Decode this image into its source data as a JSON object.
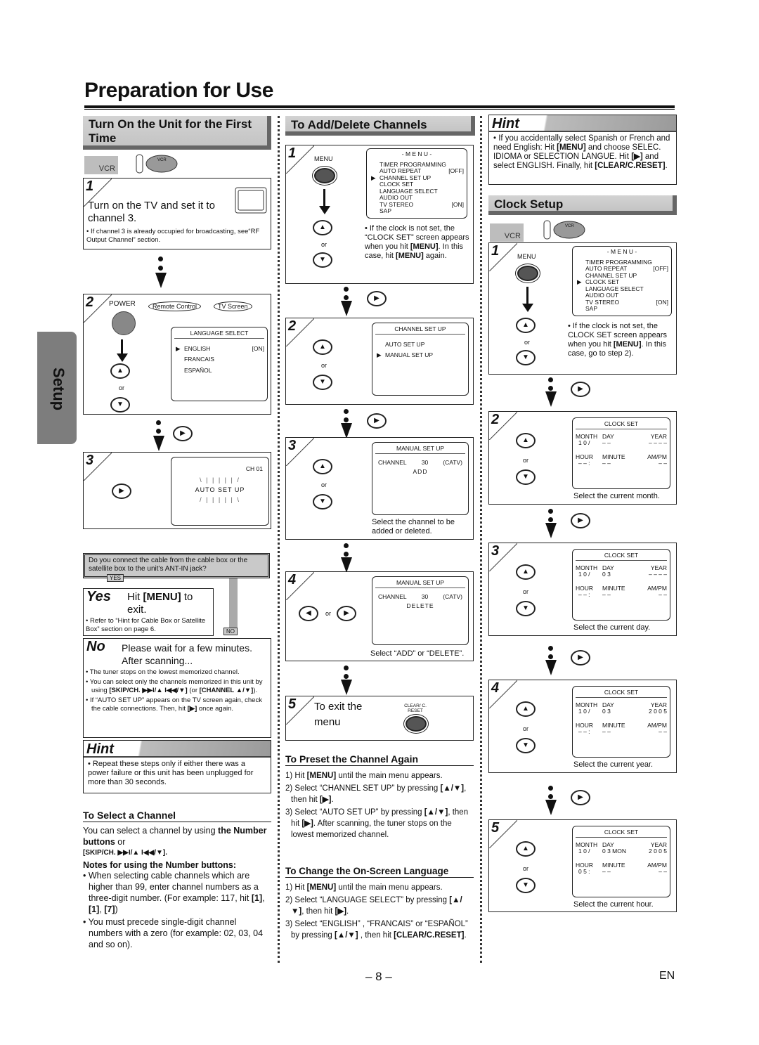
{
  "page": {
    "title": "Preparation for Use",
    "side_tab": "Setup",
    "page_number": "– 8 –",
    "language": "EN"
  },
  "col1": {
    "heading": "Turn On the Unit for the First Time",
    "vcr_label": "VCR",
    "step1": {
      "num": "1",
      "text": "Turn on the TV and set it to channel 3.",
      "note": "• If channel 3 is already occupied for broadcasting, see“RF Output Channel” section."
    },
    "step2": {
      "num": "2",
      "power_label": "POWER",
      "callout_remote": "Remote Control",
      "callout_tv": "TV Screen",
      "or": "or",
      "screen": {
        "header": "LANGUAGE SELECT",
        "items": [
          {
            "label": "ENGLISH",
            "value": "[ON]",
            "selected": true
          },
          {
            "label": "FRANCAIS",
            "value": "",
            "selected": false
          },
          {
            "label": "ESPAÑOL",
            "value": "",
            "selected": false
          }
        ]
      }
    },
    "step3": {
      "num": "3",
      "channel": "CH 01",
      "flashing": "AUTO SET UP"
    },
    "question": "Do you connect the cable from the cable box or the satellite box to the unit’s ANT-IN jack?",
    "yes_tag": "YES",
    "no_tag": "NO",
    "yes": {
      "label": "Yes",
      "text_pre": "Hit ",
      "text_key": "[MENU]",
      "text_post": " to exit.",
      "note": "• Refer to “Hint for Cable Box or Satellite Box” section on page 6."
    },
    "no": {
      "label": "No",
      "text": "Please wait for a few minutes. After scanning...",
      "notes": [
        "• The tuner stops on the lowest memorized channel.",
        "• You can select only the channels memorized in this unit by using [SKIP/CH. ▶▶I/▲ I◀◀/▼] (or [CHANNEL ▲/▼]).",
        "• If “AUTO SET UP” appears on the TV screen again, check the cable connections. Then, hit [▶] once again."
      ]
    },
    "hint": {
      "title": "Hint",
      "text": "• Repeat these steps only if either there was a power failure or this unit has been unplugged for more than 30 seconds."
    },
    "select_channel": {
      "heading": "To Select a Channel",
      "intro_pre": "You can select a channel by using ",
      "intro_bold": "the Number buttons",
      "intro_post": " or",
      "skip_key": "[SKIP/CH. ▶▶I/▲ I◀◀/▼].",
      "notes_heading": "Notes for using the Number buttons:",
      "notes": [
        "• When selecting cable channels which are higher than 99, enter channel numbers as a three-digit number. (For example: 117, hit [1], [1], [7])",
        "• You must precede single-digit channel numbers with a zero (for example: 02, 03, 04 and so on)."
      ]
    }
  },
  "col2": {
    "heading": "To Add/Delete Channels",
    "step1": {
      "num": "1",
      "menu_label": "MENU",
      "or": "or",
      "screen": {
        "header": "- M E N U -",
        "items": [
          {
            "label": "TIMER PROGRAMMING",
            "value": "",
            "selected": false
          },
          {
            "label": "AUTO REPEAT",
            "value": "[OFF]",
            "selected": false
          },
          {
            "label": "CHANNEL SET UP",
            "value": "",
            "selected": true
          },
          {
            "label": "CLOCK SET",
            "value": "",
            "selected": false
          },
          {
            "label": "LANGUAGE SELECT",
            "value": "",
            "selected": false
          },
          {
            "label": "AUDIO OUT",
            "value": "",
            "selected": false
          },
          {
            "label": "TV STEREO",
            "value": "[ON]",
            "selected": false
          },
          {
            "label": "SAP",
            "value": "",
            "selected": false
          }
        ]
      },
      "note": "• If the clock is not set, the “CLOCK SET” screen appears when you hit [MENU]. In this case, hit [MENU] again."
    },
    "step2": {
      "num": "2",
      "or": "or",
      "screen": {
        "header": "CHANNEL SET UP",
        "items": [
          {
            "label": "AUTO SET UP",
            "selected": false
          },
          {
            "label": "MANUAL SET UP",
            "selected": true
          }
        ]
      }
    },
    "step3": {
      "num": "3",
      "or": "or",
      "screen": {
        "header": "MANUAL SET UP",
        "channel_label": "CHANNEL",
        "channel_value": "30",
        "channel_type": "(CATV)",
        "flashing": "ADD"
      },
      "caption": "Select the channel to be added or deleted."
    },
    "step4": {
      "num": "4",
      "or": "or",
      "screen": {
        "header": "MANUAL SET UP",
        "channel_label": "CHANNEL",
        "channel_value": "30",
        "channel_type": "(CATV)",
        "flashing": "DELETE"
      },
      "caption": "Select “ADD” or “DELETE”."
    },
    "step5": {
      "num": "5",
      "text": "To exit the menu",
      "button_label": "CLEAR/ C. RESET"
    },
    "preset": {
      "heading": "To Preset the Channel Again",
      "steps": [
        "1) Hit [MENU] until the main menu appears.",
        "2) Select “CHANNEL SET UP” by pressing [▲/▼], then hit [▶].",
        "3) Select “AUTO SET UP” by pressing [▲/▼], then hit [▶]. After scanning, the tuner stops on the lowest memorized channel."
      ]
    },
    "language": {
      "heading": "To Change the On-Screen Language",
      "steps": [
        "1) Hit [MENU] until the main menu appears.",
        "2) Select “LANGUAGE SELECT” by pressing [▲/▼], then hit [▶].",
        "3) Select “ENGLISH” , “FRANCAIS” or “ESPAÑOL” by pressing [▲/▼] , then hit [CLEAR/C.RESET]."
      ]
    }
  },
  "col3": {
    "hint": {
      "title": "Hint",
      "text": "• If you accidentally select Spanish or French and need English: Hit [MENU] and choose SELEC. IDIOMA or SELECTION LANGUE. Hit [▶] and select ENGLISH. Finally, hit [CLEAR/C.RESET]."
    },
    "heading": "Clock Setup",
    "vcr_label": "VCR",
    "step1": {
      "num": "1",
      "menu_label": "MENU",
      "or": "or",
      "screen": {
        "header": "- M E N U -",
        "items": [
          {
            "label": "TIMER PROGRAMMING",
            "value": "",
            "selected": false
          },
          {
            "label": "AUTO REPEAT",
            "value": "[OFF]",
            "selected": false
          },
          {
            "label": "CHANNEL SET UP",
            "value": "",
            "selected": false
          },
          {
            "label": "CLOCK SET",
            "value": "",
            "selected": true
          },
          {
            "label": "LANGUAGE SELECT",
            "value": "",
            "selected": false
          },
          {
            "label": "AUDIO OUT",
            "value": "",
            "selected": false
          },
          {
            "label": "TV STEREO",
            "value": "[ON]",
            "selected": false
          },
          {
            "label": "SAP",
            "value": "",
            "selected": false
          }
        ]
      },
      "note": "• If the clock is not set, the CLOCK SET screen appears when you hit [MENU]. In this case, go to step 2)."
    },
    "clock_steps": [
      {
        "num": "2",
        "month": "1 0",
        "day": "– –",
        "weekday": "",
        "year": "– – – –",
        "hour": "– –",
        "minute": "– –",
        "ampm": "– –",
        "caption": "Select the current month."
      },
      {
        "num": "3",
        "month": "1 0",
        "day": "0 3",
        "weekday": "",
        "year": "– – – –",
        "hour": "– –",
        "minute": "– –",
        "ampm": "– –",
        "caption": "Select the current day."
      },
      {
        "num": "4",
        "month": "1 0",
        "day": "0 3",
        "weekday": "",
        "year": "2 0 0 5",
        "hour": "– –",
        "minute": "– –",
        "ampm": "– –",
        "caption": "Select the current year."
      },
      {
        "num": "5",
        "month": "1 0",
        "day": "0 3",
        "weekday": "MON",
        "year": "2 0 0 5",
        "hour": "0 5",
        "minute": "– –",
        "ampm": "– –",
        "caption": "Select the current hour."
      }
    ],
    "clock_labels": {
      "header": "CLOCK SET",
      "month": "MONTH",
      "day": "DAY",
      "year": "YEAR",
      "hour": "HOUR",
      "minute": "MINUTE",
      "ampm": "AM/PM",
      "or": "or"
    }
  }
}
